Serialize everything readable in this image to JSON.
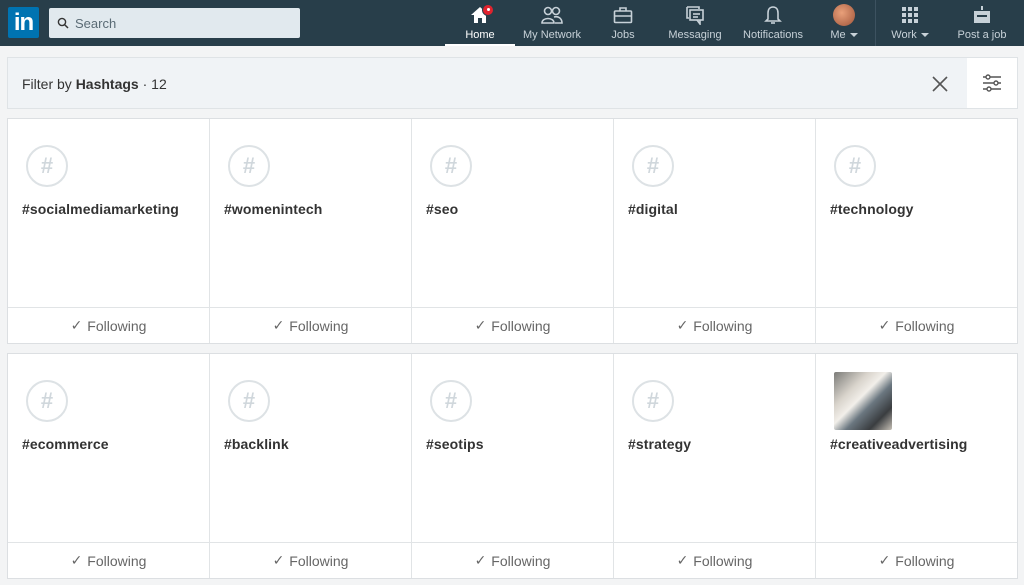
{
  "header": {
    "logo": "in",
    "search": {
      "placeholder": "Search",
      "value": ""
    },
    "nav": [
      {
        "label": "Home",
        "icon": "home-icon",
        "active": true,
        "badge": true
      },
      {
        "label": "My Network",
        "icon": "network-icon"
      },
      {
        "label": "Jobs",
        "icon": "briefcase-icon"
      },
      {
        "label": "Messaging",
        "icon": "messaging-icon"
      },
      {
        "label": "Notifications",
        "icon": "bell-icon"
      },
      {
        "label": "Me",
        "icon": "avatar",
        "dropdown": true
      },
      {
        "label": "Work",
        "icon": "grid-icon",
        "dropdown": true
      },
      {
        "label": "Post a job",
        "icon": "post-job-icon"
      }
    ]
  },
  "filter": {
    "prefix": "Filter by",
    "type": "Hashtags",
    "count": "· 12"
  },
  "hashtags": [
    {
      "tag": "#socialmediamarketing",
      "status": "Following",
      "image": false
    },
    {
      "tag": "#womenintech",
      "status": "Following",
      "image": false
    },
    {
      "tag": "#seo",
      "status": "Following",
      "image": false
    },
    {
      "tag": "#digital",
      "status": "Following",
      "image": false
    },
    {
      "tag": "#technology",
      "status": "Following",
      "image": false
    },
    {
      "tag": "#ecommerce",
      "status": "Following",
      "image": false
    },
    {
      "tag": "#backlink",
      "status": "Following",
      "image": false
    },
    {
      "tag": "#seotips",
      "status": "Following",
      "image": false
    },
    {
      "tag": "#strategy",
      "status": "Following",
      "image": false
    },
    {
      "tag": "#creativeadvertising",
      "status": "Following",
      "image": true
    }
  ],
  "colors": {
    "topbar": "#283e4a",
    "brand": "#0073b1",
    "badge": "#e0232e"
  }
}
